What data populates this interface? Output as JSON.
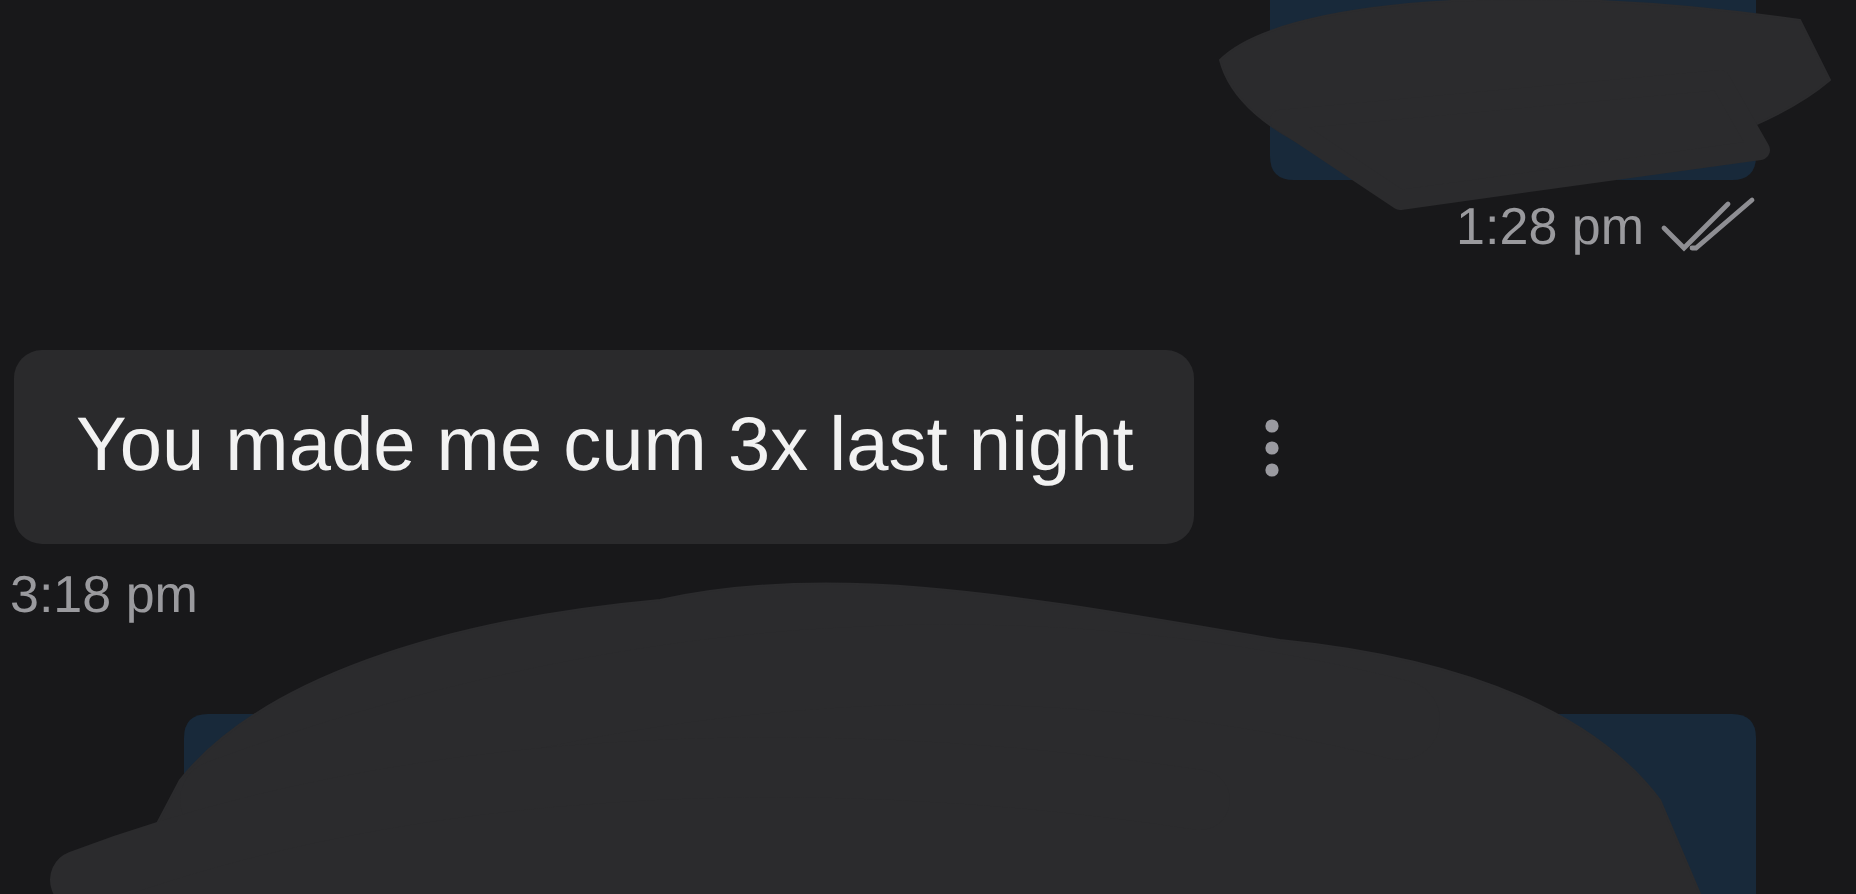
{
  "messages": [
    {
      "kind": "outgoing",
      "time": "1:28 pm",
      "read": true
    },
    {
      "kind": "incoming",
      "text": "You made me cum 3x last night",
      "time": "3:18 pm"
    },
    {
      "kind": "outgoing"
    }
  ]
}
